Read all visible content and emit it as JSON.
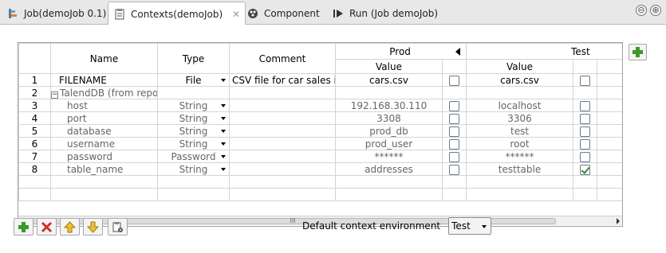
{
  "tabs": [
    {
      "label": "Job(demoJob 0.1)",
      "icon": "job-icon"
    },
    {
      "label": "Contexts(demoJob)",
      "icon": "contexts-icon",
      "active": true
    },
    {
      "label": "Component",
      "icon": "component-icon"
    },
    {
      "label": "Run (Job demoJob)",
      "icon": "run-icon"
    }
  ],
  "window_buttons": {
    "minimize": "⊖",
    "maximize": "⊕"
  },
  "table": {
    "headers": {
      "name": "Name",
      "type": "Type",
      "comment": "Comment",
      "prod": "Prod",
      "test": "Test",
      "value": "Value"
    },
    "rows": [
      {
        "num": "1",
        "name": "FILENAME",
        "type": "File",
        "comment": "CSV file for car sales info",
        "prod": "cars.csv",
        "test": "cars.csv",
        "prod_checked": false,
        "test_checked": false,
        "grey": false
      },
      {
        "num": "2",
        "name": "TalendDB (from reposit",
        "type": "",
        "comment": "",
        "prod": "",
        "test": "",
        "group": true,
        "toggle": "−"
      },
      {
        "num": "3",
        "name": "host",
        "type": "String",
        "comment": "",
        "prod": "192.168.30.110",
        "test": "localhost",
        "prod_checked": false,
        "test_checked": false,
        "grey": true
      },
      {
        "num": "4",
        "name": "port",
        "type": "String",
        "comment": "",
        "prod": "3308",
        "test": "3306",
        "prod_checked": false,
        "test_checked": false,
        "grey": true
      },
      {
        "num": "5",
        "name": "database",
        "type": "String",
        "comment": "",
        "prod": "prod_db",
        "test": "test",
        "prod_checked": false,
        "test_checked": false,
        "grey": true
      },
      {
        "num": "6",
        "name": "username",
        "type": "String",
        "comment": "",
        "prod": "prod_user",
        "test": "root",
        "prod_checked": false,
        "test_checked": false,
        "grey": true
      },
      {
        "num": "7",
        "name": "password",
        "type": "Password",
        "comment": "",
        "prod": "******",
        "test": "******",
        "prod_checked": false,
        "test_checked": false,
        "grey": true
      },
      {
        "num": "8",
        "name": "table_name",
        "type": "String",
        "comment": "",
        "prod": "addresses",
        "test": "testtable",
        "prod_checked": false,
        "test_checked": true,
        "grey": true
      }
    ]
  },
  "scrollbar_grip": "III",
  "footer": {
    "default_env_label": "Default context environment",
    "default_env_value": "Test"
  },
  "colors": {
    "add_green": "#3a9a2a",
    "remove_red": "#d03030",
    "arrow_yellow": "#e0b020"
  }
}
